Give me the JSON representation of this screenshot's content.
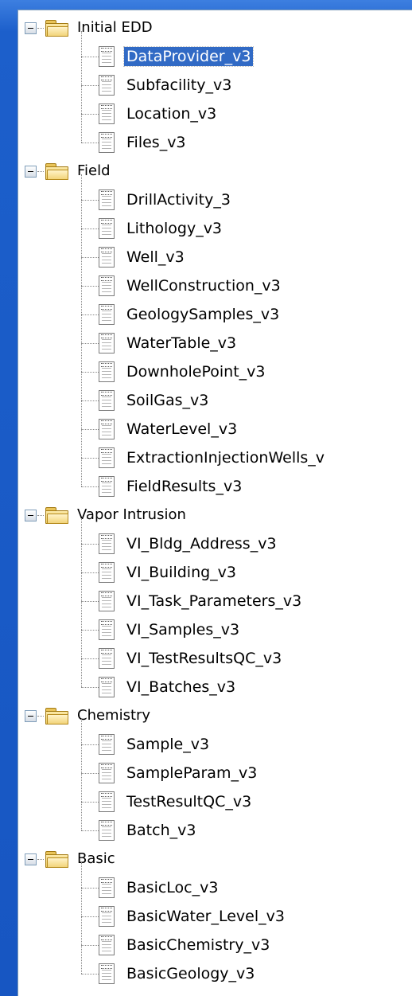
{
  "tree": {
    "groups": [
      {
        "label": "Initial EDD",
        "items": [
          "DataProvider_v3",
          "Subfacility_v3",
          "Location_v3",
          "Files_v3"
        ]
      },
      {
        "label": "Field",
        "items": [
          "DrillActivity_3",
          "Lithology_v3",
          "Well_v3",
          "WellConstruction_v3",
          "GeologySamples_v3",
          "WaterTable_v3",
          "DownholePoint_v3",
          "SoilGas_v3",
          "WaterLevel_v3",
          "ExtractionInjectionWells_v",
          "FieldResults_v3"
        ]
      },
      {
        "label": "Vapor Intrusion",
        "items": [
          "VI_Bldg_Address_v3",
          "VI_Building_v3",
          "VI_Task_Parameters_v3",
          "VI_Samples_v3",
          "VI_TestResultsQC_v3",
          "VI_Batches_v3"
        ]
      },
      {
        "label": "Chemistry",
        "items": [
          "Sample_v3",
          "SampleParam_v3",
          "TestResultQC_v3",
          "Batch_v3"
        ]
      },
      {
        "label": "Basic",
        "items": [
          "BasicLoc_v3",
          "BasicWater_Level_v3",
          "BasicChemistry_v3",
          "BasicGeology_v3"
        ]
      }
    ],
    "selected": "DataProvider_v3",
    "colors": {
      "selection": "#316ac5",
      "window_blue": "#1c5fcb"
    }
  }
}
